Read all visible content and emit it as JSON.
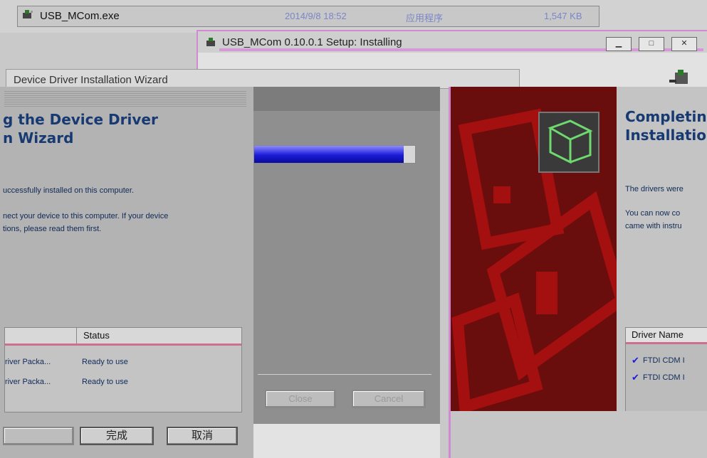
{
  "file_row": {
    "name": "USB_MCom.exe",
    "date": "2014/9/8 18:52",
    "type": "应用程序",
    "size": "1,547 KB"
  },
  "setup_window": {
    "title": "USB_MCom 0.10.0.1 Setup: Installing",
    "buttons": {
      "minimize": "▁",
      "maximize": "□",
      "close": "✕"
    },
    "progress_fraction": 0.93,
    "close_label": "Close",
    "cancel_label": "Cancel"
  },
  "wizard_left": {
    "title": "Device Driver Installation Wizard",
    "heading_line1": "g the Device Driver",
    "heading_line2": "n Wizard",
    "msg1": "uccessfully installed on this computer.",
    "msg2a": "nect your device to this computer. If your device",
    "msg2b": "tions, please read them first.",
    "table": {
      "status_header": "Status",
      "rows": [
        {
          "name": "river Packa...",
          "status": "Ready to use"
        },
        {
          "name": "river Packa...",
          "status": "Ready to use"
        }
      ]
    },
    "finish_label": "完成",
    "cancel_label": "取消"
  },
  "wizard_right": {
    "heading_line1": "Completin",
    "heading_line2": "Installatio",
    "msg1": "The drivers were",
    "msg2a": "You can now co",
    "msg2b": "came with instru",
    "table": {
      "header": "Driver Name",
      "rows": [
        "FTDI CDM I",
        "FTDI CDM I"
      ]
    }
  },
  "colors": {
    "heading": "#173a72",
    "progress": "#1b1bd9",
    "art_bg": "#6a0d0d",
    "art_fg": "#a40f0f",
    "accent": "#d08ad0"
  }
}
